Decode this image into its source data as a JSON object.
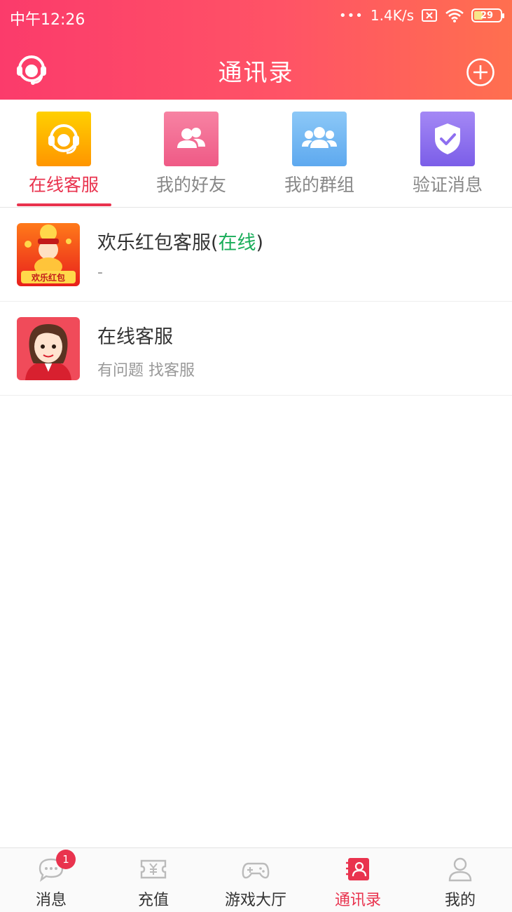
{
  "status_bar": {
    "time": "中午12:26",
    "dots": "•••",
    "speed": "1.4K/s",
    "battery": "29"
  },
  "header": {
    "title": "通讯录",
    "left_icon": "customer-service-icon",
    "right_icon": "add-circle-icon"
  },
  "tabs": [
    {
      "label": "在线客服",
      "icon": "headset-icon",
      "active": true,
      "color": "#ffb300"
    },
    {
      "label": "我的好友",
      "icon": "friends-icon",
      "active": false,
      "color": "#f2668c"
    },
    {
      "label": "我的群组",
      "icon": "group-icon",
      "active": false,
      "color": "#6fb6f5"
    },
    {
      "label": "验证消息",
      "icon": "shield-check-icon",
      "active": false,
      "color": "#8e6ff0"
    }
  ],
  "contacts": [
    {
      "name": "欢乐红包客服",
      "paren_open": "(",
      "status": "在线",
      "paren_close": ")",
      "subtitle": "-",
      "avatar_text": "欢乐红包"
    },
    {
      "name": "在线客服",
      "subtitle": "有问题 找客服"
    }
  ],
  "bottom_nav": [
    {
      "label": "消息",
      "icon": "message-icon",
      "badge": "1",
      "active": false
    },
    {
      "label": "充值",
      "icon": "recharge-ticket-icon",
      "badge": "",
      "active": false
    },
    {
      "label": "游戏大厅",
      "icon": "gamepad-icon",
      "badge": "",
      "active": false
    },
    {
      "label": "通讯录",
      "icon": "contacts-icon",
      "badge": "",
      "active": true
    },
    {
      "label": "我的",
      "icon": "profile-icon",
      "badge": "",
      "active": false
    }
  ],
  "colors": {
    "accent": "#e9334e",
    "online": "#1aad5a",
    "header_gradient_start": "#fb3b6b",
    "header_gradient_end": "#ff6f4f"
  }
}
